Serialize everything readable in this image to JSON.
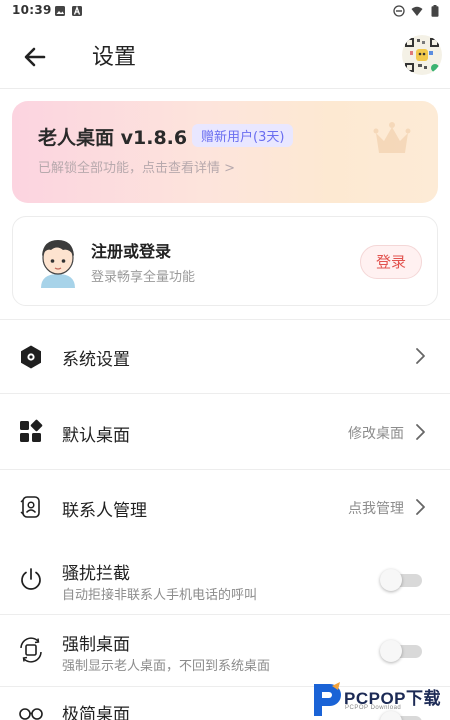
{
  "status_bar": {
    "time": "10:39"
  },
  "header": {
    "title": "设置"
  },
  "vip_card": {
    "title": "老人桌面 v1.8.6",
    "badge": "赠新用户(3天)",
    "subtitle": "已解锁全部功能，点击查看详情 >"
  },
  "login_card": {
    "title": "注册或登录",
    "subtitle": "登录畅享全量功能",
    "button": "登录"
  },
  "settings": [
    {
      "label": "系统设置",
      "icon": "hexagon-gear-icon"
    },
    {
      "label": "默认桌面",
      "icon": "apps-grid-icon",
      "value": "修改桌面"
    },
    {
      "label": "联系人管理",
      "icon": "contact-sync-icon",
      "value": "点我管理"
    },
    {
      "label": "骚扰拦截",
      "icon": "power-icon",
      "subtitle": "自动拒接非联系人手机电话的呼叫",
      "toggle": false
    },
    {
      "label": "强制桌面",
      "icon": "screen-rotate-icon",
      "subtitle": "强制显示老人桌面，不回到系统桌面",
      "toggle": false
    },
    {
      "label": "极简桌面",
      "icon": "glasses-icon",
      "toggle": false
    }
  ],
  "watermark": {
    "brand": "PCPOP下载",
    "sub": "PCPOP Download"
  },
  "colors": {
    "accent_red": "#e2534f",
    "badge_purple": "#6a6ef0"
  }
}
